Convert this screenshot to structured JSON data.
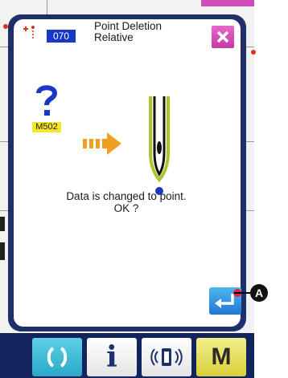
{
  "dialog": {
    "code": "070",
    "title_line1": "Point Deletion",
    "title_line2": "Relative",
    "message_code": "M502",
    "message_line1": "Data is changed to point.",
    "message_line2": "OK ?"
  },
  "icons": {
    "marker": "point-marker-icon",
    "close": "close-icon",
    "question": "question-mark-icon",
    "arrow": "right-arrow-icon",
    "needle": "needle-icon",
    "enter": "enter-icon",
    "reset": "reset-icon",
    "info": "info-icon",
    "communication": "communication-icon",
    "mode": "mode-icon"
  },
  "callout": {
    "label": "A"
  },
  "bottom_bar": {
    "mode_label": "M",
    "info_label": "i"
  },
  "colors": {
    "dialog_border": "#1e2f6a",
    "code_badge": "#1a38c8",
    "close_button": "#d04cb8",
    "message_code_bg": "#f5e62a",
    "arrow": "#f0a020",
    "needle_outline": "#a8c828",
    "enter_button": "#2f8fe0",
    "bottom_bar": "#12245e"
  }
}
